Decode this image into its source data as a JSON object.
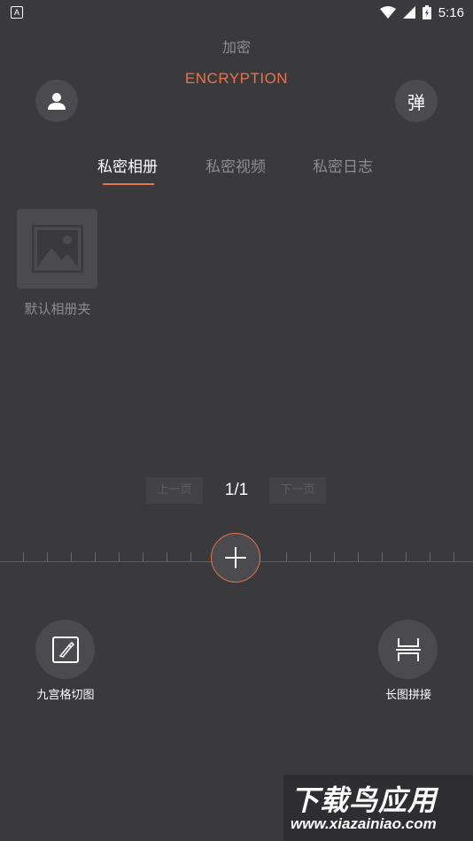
{
  "status_bar": {
    "app_icon_glyph": "A",
    "time": "5:16",
    "icons": [
      "wifi-icon",
      "signal-icon",
      "battery-icon"
    ]
  },
  "header": {
    "title_cn": "加密",
    "title_en": "ENCRYPTION",
    "pop_label": "弹",
    "user_icon": "user-icon"
  },
  "tabs": [
    {
      "label": "私密相册",
      "active": true
    },
    {
      "label": "私密视频",
      "active": false
    },
    {
      "label": "私密日志",
      "active": false
    }
  ],
  "albums": [
    {
      "label": "默认相册夹",
      "icon": "image-icon"
    }
  ],
  "pager": {
    "prev_label": "上一页",
    "page": "1/1",
    "next_label": "下一页"
  },
  "add_button": {
    "icon": "plus-icon"
  },
  "tools": [
    {
      "label": "九宫格切图",
      "icon": "knife-icon"
    },
    {
      "label": "长图拼接",
      "icon": "stitch-icon"
    }
  ],
  "watermark": {
    "title": "下载鸟应用",
    "url": "www.xiazainiao.com"
  },
  "colors": {
    "background": "#3a3a3d",
    "accent": "#e5744e",
    "muted": "#8d8d90"
  }
}
